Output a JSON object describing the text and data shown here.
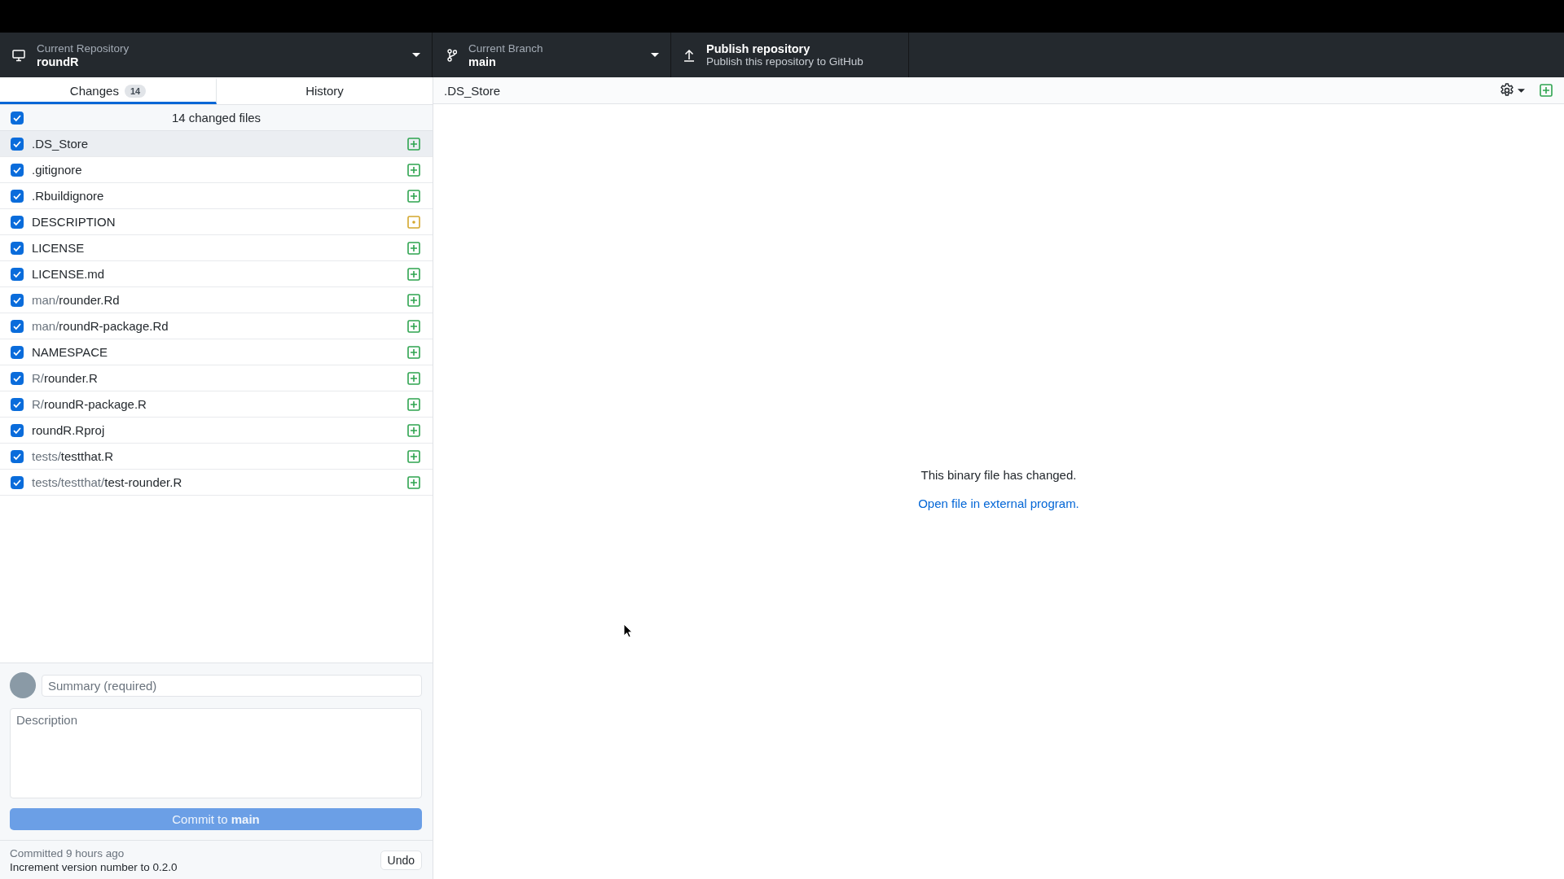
{
  "toolbar": {
    "repository": {
      "label": "Current Repository",
      "value": "roundR"
    },
    "branch": {
      "label": "Current Branch",
      "value": "main"
    },
    "publish": {
      "title": "Publish repository",
      "subtitle": "Publish this repository to GitHub"
    }
  },
  "tabs": [
    {
      "label": "Changes",
      "count": "14",
      "selected": true
    },
    {
      "label": "History",
      "selected": false
    }
  ],
  "changes": {
    "header": {
      "label": "14 changed files",
      "checked": true
    },
    "files": [
      {
        "name": ".DS_Store",
        "checked": true,
        "selected": true,
        "kind": "added"
      },
      {
        "name": ".gitignore",
        "checked": true,
        "selected": false,
        "kind": "added"
      },
      {
        "name": ".Rbuildignore",
        "checked": true,
        "selected": false,
        "kind": "added"
      },
      {
        "name": "DESCRIPTION",
        "checked": true,
        "selected": false,
        "kind": "modified"
      },
      {
        "name": "LICENSE",
        "checked": true,
        "selected": false,
        "kind": "added"
      },
      {
        "name": "LICENSE.md",
        "checked": true,
        "selected": false,
        "kind": "added"
      },
      {
        "folder": "man/",
        "name": "rounder.Rd",
        "checked": true,
        "selected": false,
        "kind": "added"
      },
      {
        "folder": "man/",
        "name": "roundR-package.Rd",
        "checked": true,
        "selected": false,
        "kind": "added"
      },
      {
        "name": "NAMESPACE",
        "checked": true,
        "selected": false,
        "kind": "added"
      },
      {
        "folder": "R/",
        "name": "rounder.R",
        "checked": true,
        "selected": false,
        "kind": "added"
      },
      {
        "folder": "R/",
        "name": "roundR-package.R",
        "checked": true,
        "selected": false,
        "kind": "added"
      },
      {
        "name": "roundR.Rproj",
        "checked": true,
        "selected": false,
        "kind": "added"
      },
      {
        "folder": "tests/",
        "name": "testthat.R",
        "checked": true,
        "selected": false,
        "kind": "added"
      },
      {
        "folder": "tests/testthat/",
        "name": "test-rounder.R",
        "checked": true,
        "selected": false,
        "kind": "added"
      }
    ]
  },
  "commit": {
    "summary_field": {
      "placeholder": "Summary (required)"
    },
    "description_field": {
      "placeholder": "Description"
    },
    "button": {
      "label": "Commit to **main**",
      "disabled": true
    }
  },
  "last_commit": {
    "time": "Committed 9 hours ago",
    "message": "Increment version number to 0.2.0",
    "undo": "Undo"
  },
  "diff": {
    "file": ".DS_Store",
    "message": "This binary file has changed.",
    "link": "Open file in external program."
  }
}
